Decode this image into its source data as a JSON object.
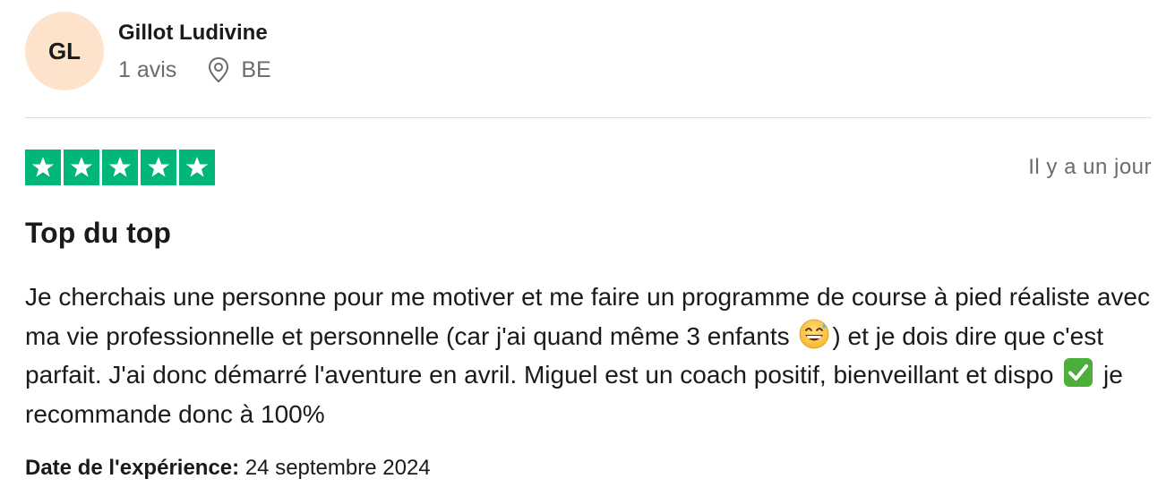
{
  "reviewer": {
    "initials": "GL",
    "name": "Gillot Ludivine",
    "review_count": "1 avis",
    "country": "BE",
    "avatar_color": "#fde3cc"
  },
  "rating": {
    "stars": 5,
    "max": 5,
    "color": "#00b67a"
  },
  "review": {
    "posted": "Il y a un jour",
    "title": "Top du top",
    "body_part1": "Je cherchais une personne pour me motiver et me faire un programme de course à pied réaliste avec ma vie professionnelle et personnelle (car j'ai quand même 3 enfants ",
    "body_part2": ") et je dois dire que c'est parfait. J'ai donc démarré l'aventure en avril. Miguel est un coach positif, bienveillant et dispo ",
    "body_part3": " je recommande donc à 100%",
    "emoji_1": "grinning-face-with-sweat-icon",
    "emoji_2": "check-mark-button-icon"
  },
  "experience": {
    "label": "Date de l'expérience:",
    "date": "24 septembre 2024"
  }
}
